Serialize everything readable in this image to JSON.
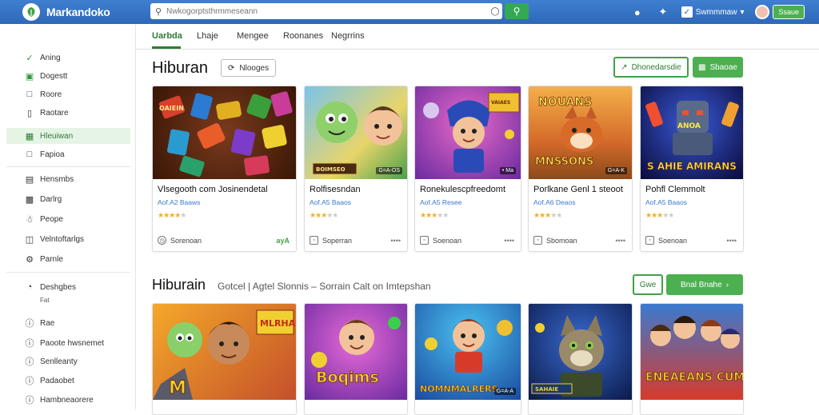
{
  "app": {
    "title": "Markandoko",
    "search_placeholder": "Nwkogorptsthrmmeseann",
    "account_label": "Swmmmaw",
    "user_button": "Ssaue"
  },
  "sidebar": {
    "items": [
      {
        "label": "Aning",
        "icon": "check-icon"
      },
      {
        "label": "Dogestt",
        "icon": "green-square-icon"
      },
      {
        "label": "Roore",
        "icon": "square-icon"
      },
      {
        "label": "Raotare",
        "icon": "bookmark-icon"
      },
      {
        "label": "Hleuiwan",
        "icon": "gamepad-icon",
        "active": true
      },
      {
        "label": "Fapioa",
        "icon": "folder-icon"
      },
      {
        "label": "Hensmbs",
        "icon": "list-icon"
      },
      {
        "label": "Darlrg",
        "icon": "grid-icon"
      },
      {
        "label": "Peope",
        "icon": "people-icon"
      },
      {
        "label": "Velntoftarlgs",
        "icon": "puzzle-icon"
      },
      {
        "label": "Parnle",
        "icon": "gear-icon"
      },
      {
        "label": "Deshgbes",
        "icon": "settings-icon",
        "sub": "Fat"
      },
      {
        "label": "Rae",
        "icon": "info-icon"
      },
      {
        "label": "Paoote hwsnemet",
        "icon": "info-icon"
      },
      {
        "label": "Senlleanty",
        "icon": "info-icon"
      },
      {
        "label": "Padaobet",
        "icon": "info-icon"
      },
      {
        "label": "Hambneaorere",
        "icon": "info-icon"
      }
    ]
  },
  "tabs": [
    "Uarbda",
    "Lhaje",
    "Mengee",
    "Roonanes",
    "Negrrins"
  ],
  "section1": {
    "title": "Hiburan",
    "chip": "Nlooges",
    "outline_btn": "Dhonedarsdie",
    "solid_btn": "Sbaoae",
    "cards": [
      {
        "title": "Vlsegooth com Josinendetal",
        "sub": "Aof.A2  Baaws",
        "rating": 4,
        "foot": "Sorenoan",
        "more": "ayA"
      },
      {
        "title": "Rolfisesndan",
        "sub": "Aof.A5  Baaos",
        "rating": 3,
        "foot": "Soperran",
        "more": "••••"
      },
      {
        "title": "Ronekulescpfreedomt",
        "sub": "Aof.A5  Resee",
        "rating": 3,
        "foot": "Soenoan",
        "more": "••••"
      },
      {
        "title": "Porlkane Genl 1 steoot",
        "sub": "Aof.A6  Deaos",
        "rating": 3,
        "foot": "Sbomoan",
        "more": "••••"
      },
      {
        "title": "Pohfl Clemmolt",
        "sub": "Aof.A5  Baaos",
        "rating": 3,
        "foot": "Soenoan",
        "more": "••••"
      }
    ]
  },
  "section2": {
    "title": "Hiburain",
    "subtitle": "Gotcel | Agtel Slonnis – Sorrain Calt on Imtepshan",
    "outline_btn": "Gwe",
    "solid_btn": "Bnal Bnahe",
    "cards": [
      {
        "art_text": "MLRHA"
      },
      {
        "art_text": "Boqims"
      },
      {
        "art_text": "NOMNMALRERS"
      },
      {
        "art_text": ""
      },
      {
        "art_text": "ENEAEANS CUMEE"
      }
    ]
  },
  "card_art": {
    "a1": "OAIEIN",
    "a2": "BOIMSEO",
    "a3": "VAIAES",
    "a4": "NOUANS",
    "a5": "MNSSONS",
    "a6": "ANOA",
    "a7": "S AHIE AMIRANS",
    "b1": "SAHAIE"
  },
  "badges": [
    "G=A-OS",
    "• Ma",
    "G=A-K",
    "G=A-A",
    "G=A-K"
  ],
  "colors": {
    "topbar": "#3572c4",
    "accent": "#4caf50",
    "active_text": "#2e7d32"
  }
}
